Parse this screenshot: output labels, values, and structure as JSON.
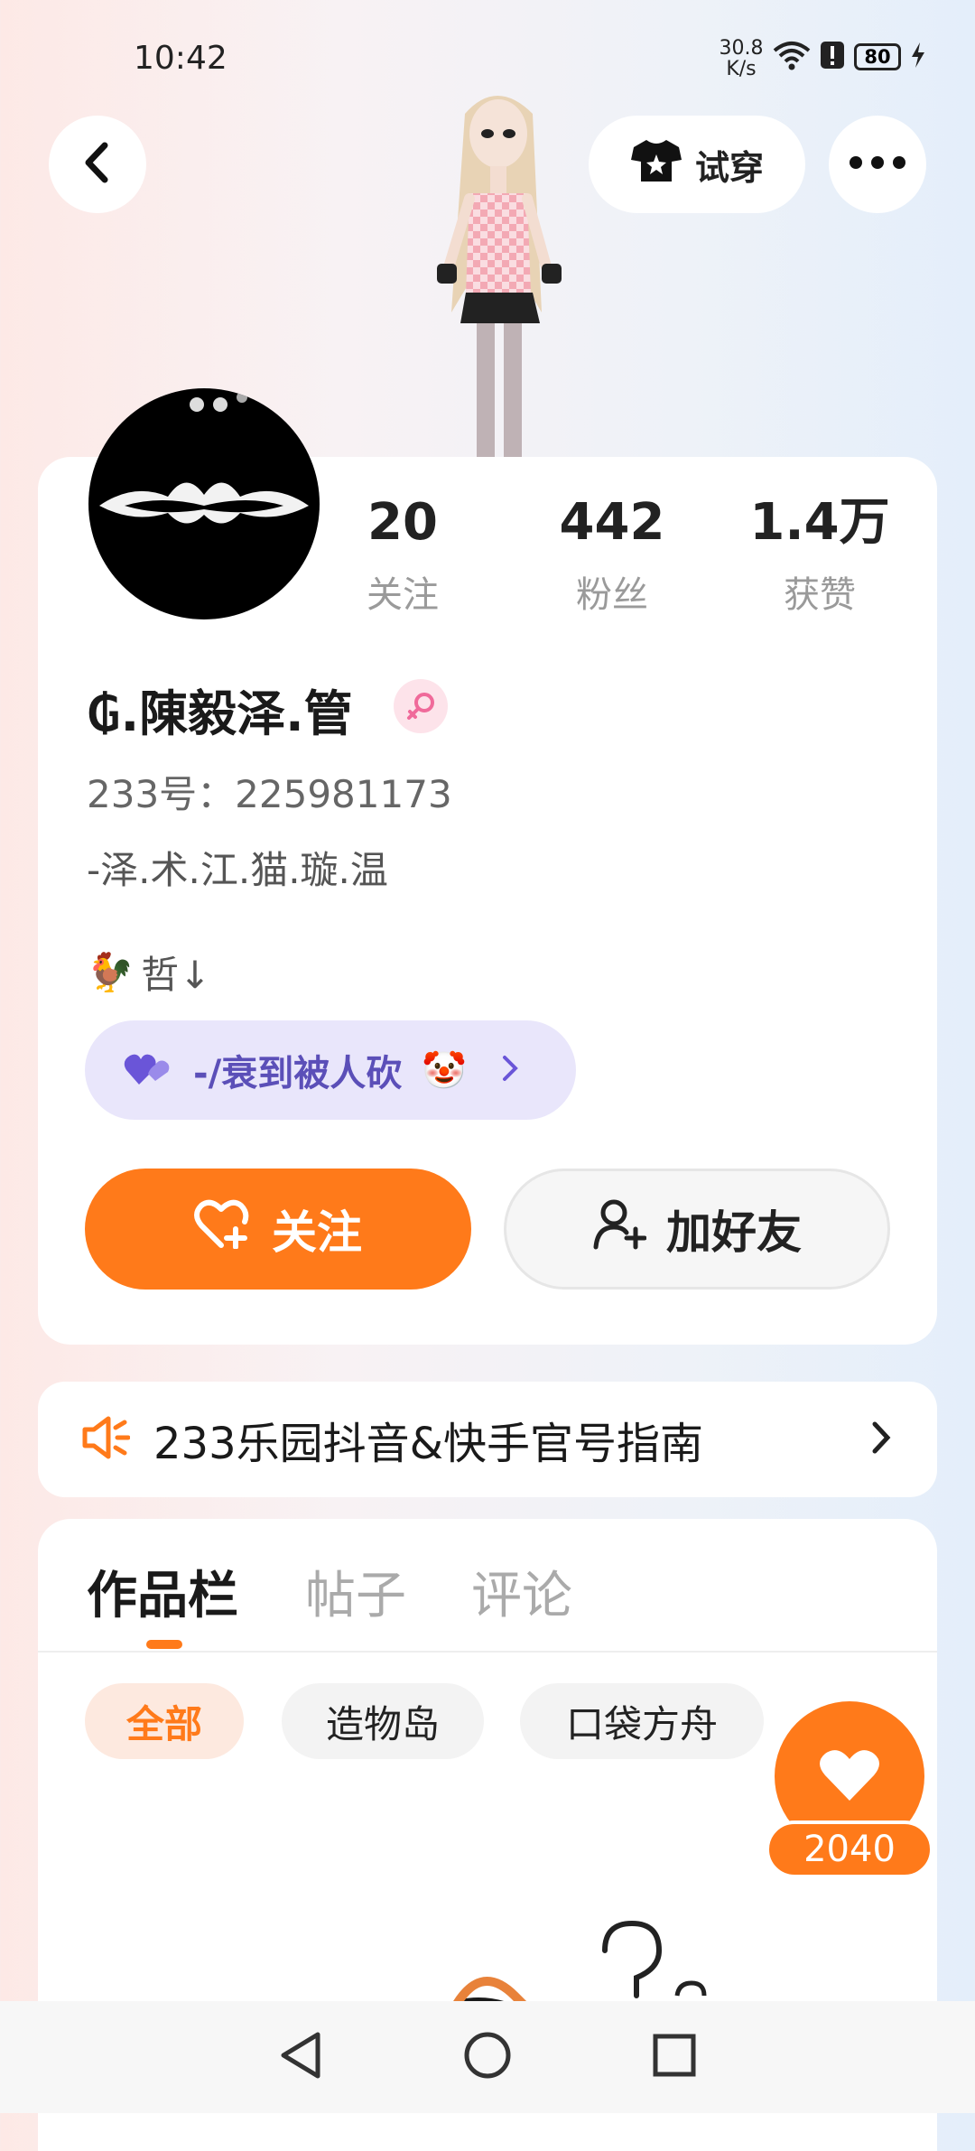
{
  "status_bar": {
    "time": "10:42",
    "net_speed_value": "30.8",
    "net_speed_unit": "K/s",
    "battery": "80"
  },
  "header": {
    "tryon_label": "试穿"
  },
  "stats": {
    "following": {
      "value": "20",
      "label": "关注"
    },
    "fans": {
      "value": "442",
      "label": "粉丝"
    },
    "likes": {
      "value": "1.4万",
      "label": "获赞"
    }
  },
  "profile": {
    "username": "₲.陳毅泽.管",
    "uid": "233号：225981173",
    "signature": "-泽.术.江.猫.璇.温",
    "tag_emoji": "🐓",
    "tag_text": "哲↓",
    "pill_text": "-/衰到被人砍",
    "pill_emoji": "🤡"
  },
  "actions": {
    "follow_label": "关注",
    "add_friend_label": "加好友"
  },
  "notice": {
    "text": "233乐园抖音&快手官号指南"
  },
  "tabs": [
    {
      "label": "作品栏",
      "active": true
    },
    {
      "label": "帖子",
      "active": false
    },
    {
      "label": "评论",
      "active": false
    }
  ],
  "filters": [
    {
      "label": "全部",
      "active": true
    },
    {
      "label": "造物岛",
      "active": false
    },
    {
      "label": "口袋方舟",
      "active": false
    }
  ],
  "like_fab": {
    "count": "2040"
  },
  "colors": {
    "accent": "#ff7a1a",
    "pill_bg": "#e9e6fb",
    "pill_text": "#5b4fb8"
  }
}
